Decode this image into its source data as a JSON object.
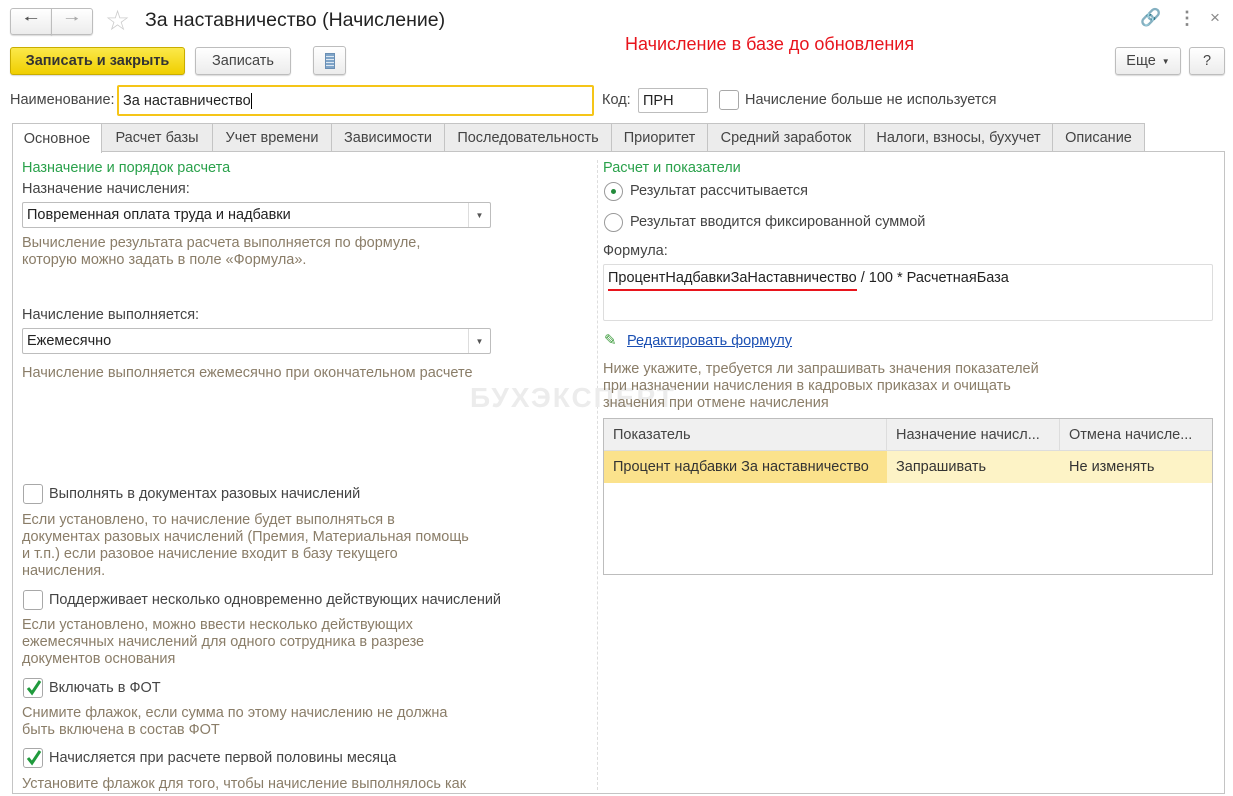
{
  "window": {
    "title": "За наставничество (Начисление)",
    "annotation": "Начисление в базе до обновления"
  },
  "toolbar": {
    "save_close": "Записать и закрыть",
    "save": "Записать",
    "more": "Еще",
    "help": "?"
  },
  "fields": {
    "name_label": "Наименование:",
    "name_value": "За наставничество",
    "code_label": "Код:",
    "code_value": "ПРН",
    "unused_label": "Начисление больше не используется"
  },
  "tabs": [
    "Основное",
    "Расчет базы",
    "Учет времени",
    "Зависимости",
    "Последовательность",
    "Приоритет",
    "Средний заработок",
    "Налоги, взносы, бухучет",
    "Описание"
  ],
  "left": {
    "section_title": "Назначение и порядок расчета",
    "purpose_label": "Назначение начисления:",
    "purpose_value": "Повременная оплата труда и надбавки",
    "purpose_hint": [
      "Вычисление результата расчета выполняется по формуле,",
      "которую можно задать в поле «Формула»."
    ],
    "period_label": "Начисление выполняется:",
    "period_value": "Ежемесячно",
    "period_hint": "Начисление выполняется ежемесячно при окончательном расчете",
    "checks": [
      {
        "label": "Выполнять в документах разовых начислений",
        "checked": false,
        "hint": [
          "Если установлено, то начисление будет выполняться в",
          "документах разовых начислений (Премия, Материальная помощь",
          "и т.п.) если разовое начисление входит в базу текущего",
          "начисления."
        ]
      },
      {
        "label": "Поддерживает несколько одновременно действующих начислений",
        "checked": false,
        "hint": [
          "Если установлено, можно ввести несколько действующих",
          "ежемесячных начислений для одного сотрудника в разрезе",
          "документов основания"
        ]
      },
      {
        "label": "Включать в ФОТ",
        "checked": true,
        "hint": [
          "Снимите флажок, если сумма по этому начислению не должна",
          "быть включена в состав ФОТ"
        ]
      },
      {
        "label": "Начисляется при расчете первой половины месяца",
        "checked": true,
        "hint": [
          "Установите флажок для того, чтобы начисление выполнялось как"
        ]
      }
    ]
  },
  "right": {
    "section_title": "Расчет и показатели",
    "radio_calc": "Результат рассчитывается",
    "radio_fixed": "Результат вводится фиксированной суммой",
    "formula_label": "Формула:",
    "formula_part1": "ПроцентНадбавкиЗаНаставничество",
    "formula_part2": " / 100 * РасчетнаяБаза",
    "edit_formula": "Редактировать формулу",
    "hint": [
      "Ниже укажите, требуется ли запрашивать значения показателей",
      "при назначении начисления в кадровых приказах и очищать",
      "значения при отмене начисления"
    ],
    "table": {
      "headers": [
        "Показатель",
        "Назначение начисл...",
        "Отмена начисле..."
      ],
      "rows": [
        [
          "Процент надбавки За наставничество",
          "Запрашивать",
          "Не изменять"
        ]
      ]
    }
  },
  "watermark": "БУХЭКСПЕРТ",
  "colors": {
    "accent_yellow": "#f5d800",
    "green": "#2aa14b",
    "annotation_red": "#e8141c",
    "link": "#1a4fb3"
  }
}
